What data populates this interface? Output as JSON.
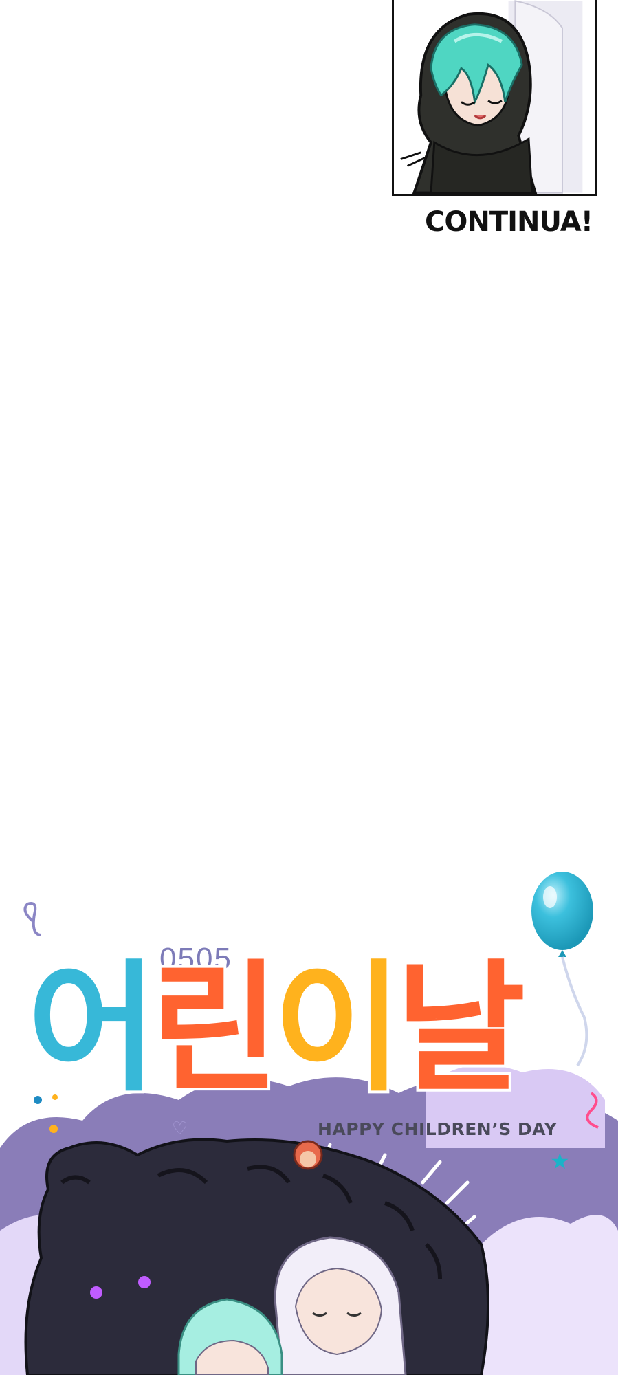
{
  "panel": {
    "caption": "CONTINUA!",
    "character_icon": "hooded-character-icon"
  },
  "banner": {
    "date_label": "0505",
    "title_chars": [
      "어",
      "린",
      "이",
      "날"
    ],
    "subtitle": "HAPPY CHILDREN’S DAY",
    "colors": {
      "cyan": "#37b8d8",
      "orange": "#ff6330",
      "yellow": "#ffb21d",
      "lavender": "#b9a7e6",
      "balloon": "#3cc0dd"
    }
  }
}
